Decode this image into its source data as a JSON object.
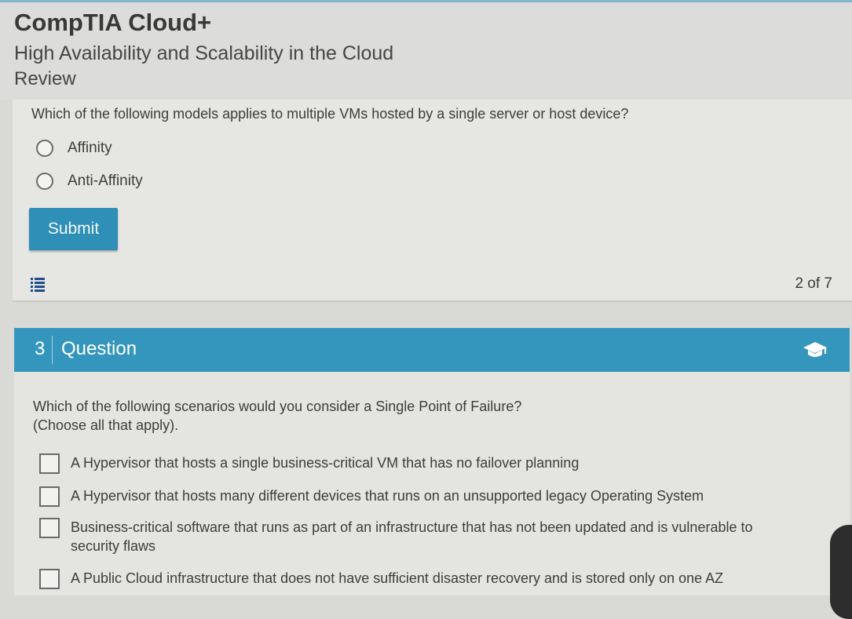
{
  "header": {
    "course_title": "CompTIA Cloud+",
    "module_title": "High Availability and Scalability in the Cloud",
    "section_title": "Review"
  },
  "question2": {
    "text": "Which of the following models applies to multiple VMs hosted by a single server or host device?",
    "options": [
      "Affinity",
      "Anti-Affinity"
    ],
    "submit_label": "Submit",
    "progress": "2 of 7"
  },
  "question3": {
    "number": "3",
    "label": "Question",
    "text": "Which of the following scenarios would you consider a Single Point of Failure?",
    "instruction": "(Choose all that apply).",
    "options": [
      "A Hypervisor that hosts a single business-critical VM that has no failover planning",
      "A Hypervisor that hosts many different devices that runs on an unsupported legacy Operating System",
      "Business-critical software that runs as part of an infrastructure that has not been updated and is vulnerable to security flaws",
      "A Public Cloud infrastructure that does not have sufficient disaster recovery and is stored only on one AZ"
    ]
  },
  "icons": {
    "list": "list-icon",
    "graduation_cap": "graduation-cap-icon"
  },
  "colors": {
    "accent": "#3596bd",
    "button": "#2f8fb6",
    "background": "#d9d9d6"
  }
}
